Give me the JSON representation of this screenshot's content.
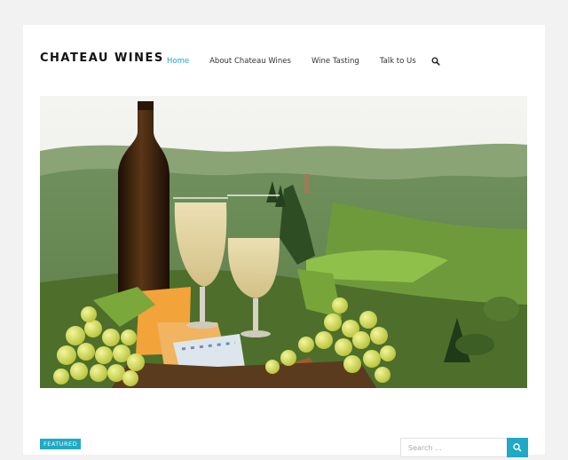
{
  "site": {
    "title": "CHATEAU WINES"
  },
  "nav": {
    "items": [
      {
        "label": "Home",
        "active": true
      },
      {
        "label": "About Chateau Wines",
        "active": false
      },
      {
        "label": "Wine Tasting",
        "active": false
      },
      {
        "label": "Talk to Us",
        "active": false
      }
    ],
    "search_icon": "search-icon"
  },
  "hero": {
    "image": "wine-bottle-glasses-grapes-cheese-vineyard-hills"
  },
  "post": {
    "badge": "FEATURED"
  },
  "sidebar": {
    "search": {
      "placeholder": "Search ...",
      "button_icon": "search-icon"
    }
  },
  "colors": {
    "accent": "#1fa9c5",
    "page_bg": "#f2f2f2"
  }
}
